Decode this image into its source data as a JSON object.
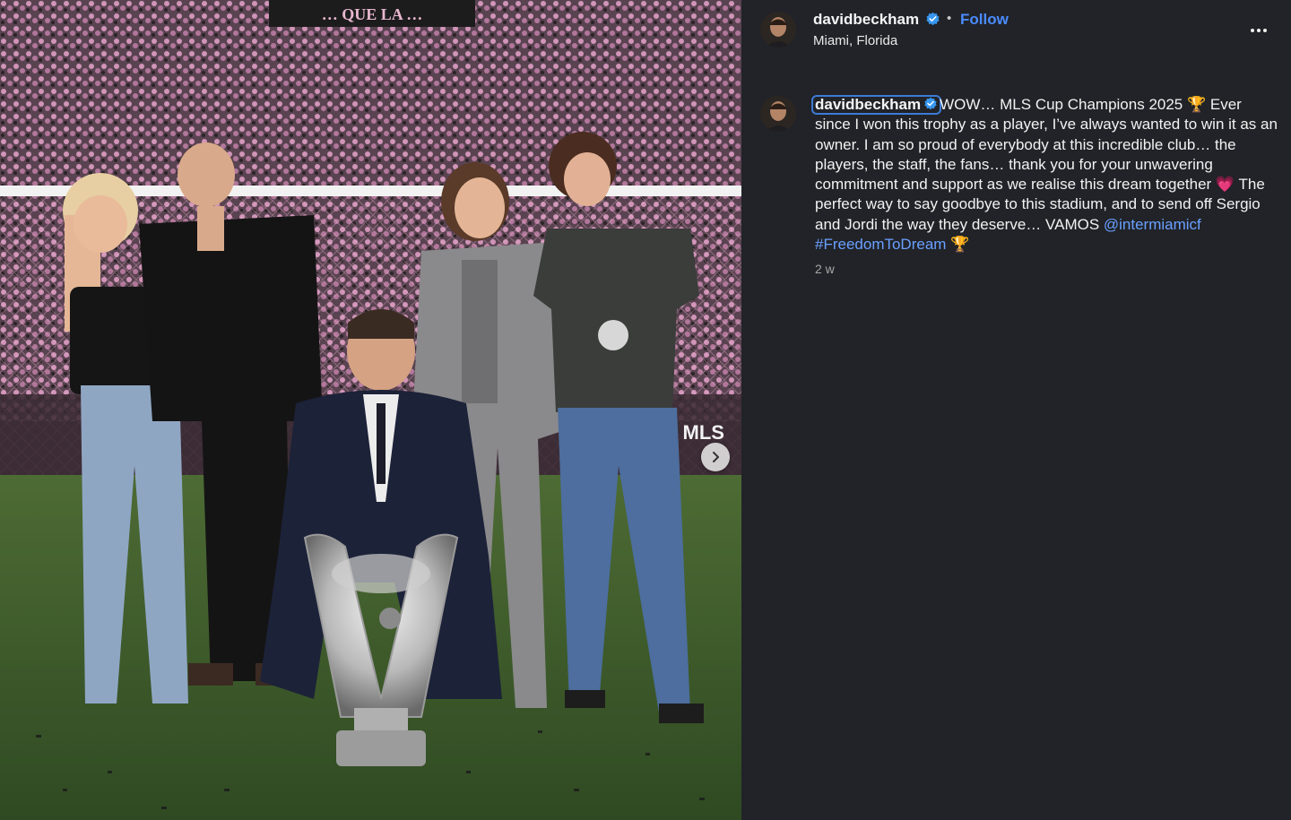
{
  "post": {
    "username": "davidbeckham",
    "location": "Miami, Florida",
    "follow_label": "Follow",
    "separator": "•",
    "caption": {
      "part1": "WOW… MLS Cup Champions 2025 🏆 Ever since I won this trophy as a player, I’ve always wanted to win it as an owner. I am so proud of everybody at this incredible club… the players, the staff, the fans… thank you for your unwavering commitment and support as we realise this dream together 💗 The perfect way to say goodbye to this stadium, and to send off Sergio and Jordi the way they deserve… VAMOS ",
      "mention": "@intermiamicf",
      "hashtag": "#FreedomToDream",
      "trailing": " 🏆"
    },
    "timestamp": "2 w"
  },
  "photo": {
    "banner_text": "… QUE LA …",
    "board_text": "MLS"
  },
  "icons": {
    "verified": "verified-badge-icon",
    "more": "more-options-icon",
    "next": "chevron-right-icon"
  },
  "colors": {
    "panel_bg": "#212328",
    "link": "#6aa0ff",
    "follow": "#4a8cff",
    "verified": "#3897f0",
    "pitch": "#3a5a2c",
    "crowd_pink": "#d88fb6"
  }
}
